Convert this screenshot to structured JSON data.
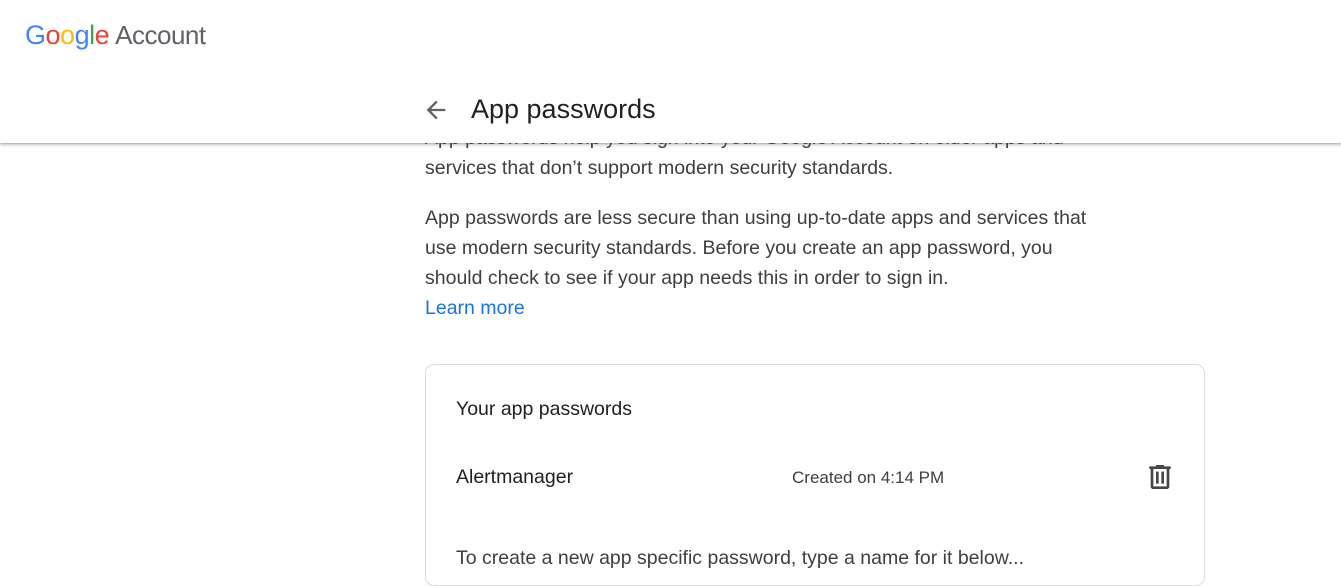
{
  "header": {
    "logo_letters": [
      "G",
      "o",
      "o",
      "g",
      "l",
      "e"
    ],
    "product": "Account"
  },
  "subheader": {
    "title": "App passwords"
  },
  "intro": {
    "partial_line": "App passwords help you sign into your Google Account on older apps and",
    "line2": "services that don’t support modern security standards.",
    "warning": "App passwords are less secure than using up-to-date apps and services that use modern security standards. Before you create an app password, you should check to see if your app needs this in order to sign in.",
    "learn_more": "Learn more"
  },
  "card": {
    "title": "Your app passwords",
    "passwords": [
      {
        "name": "Alertmanager",
        "created": "Created on 4:14 PM"
      }
    ],
    "partial_text": "To create a new app specific password, type a name for it below..."
  },
  "icons": {
    "back": "arrow-back-icon",
    "delete": "trash-icon"
  },
  "colors": {
    "link": "#1a73e8",
    "text": "#3c4043",
    "border": "#dadce0"
  }
}
